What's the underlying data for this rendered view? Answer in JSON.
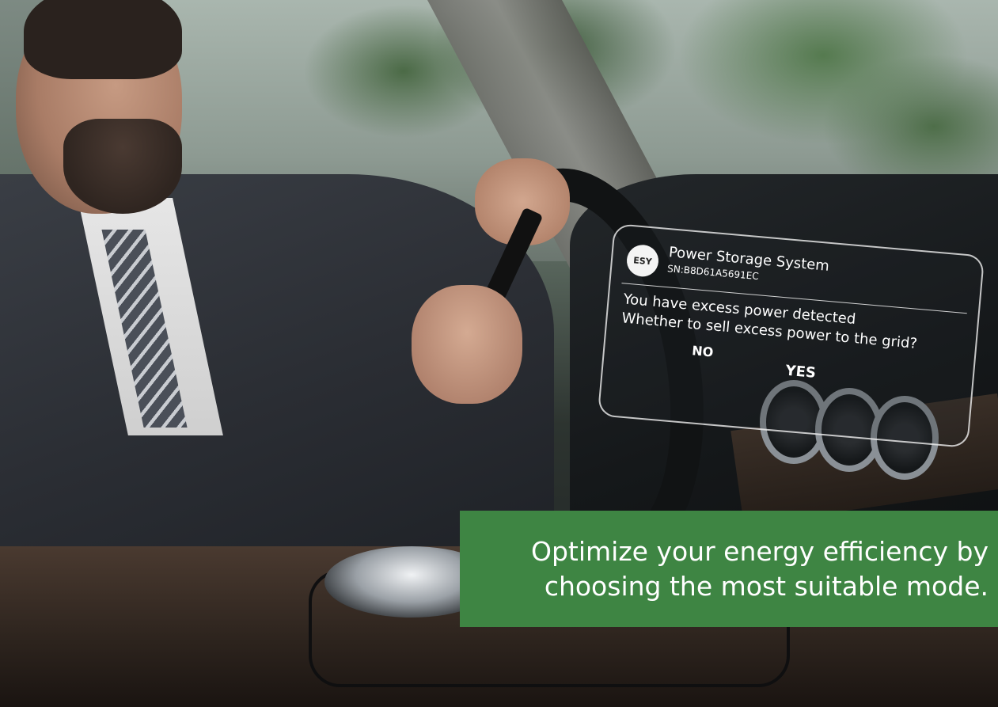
{
  "notification": {
    "logo_text": "ESY",
    "title": "Power  Storage System",
    "serial": "SN:B8D61A5691EC",
    "message_line1": "You have excess power detected",
    "message_line2": "Whether to sell excess power to the grid?",
    "no_label": "NO",
    "yes_label": "YES"
  },
  "caption": {
    "line1": "Optimize your energy efficiency by",
    "line2": "choosing the most suitable mode."
  },
  "colors": {
    "banner_green": "#3e8543",
    "card_outline": "#ffffff"
  }
}
